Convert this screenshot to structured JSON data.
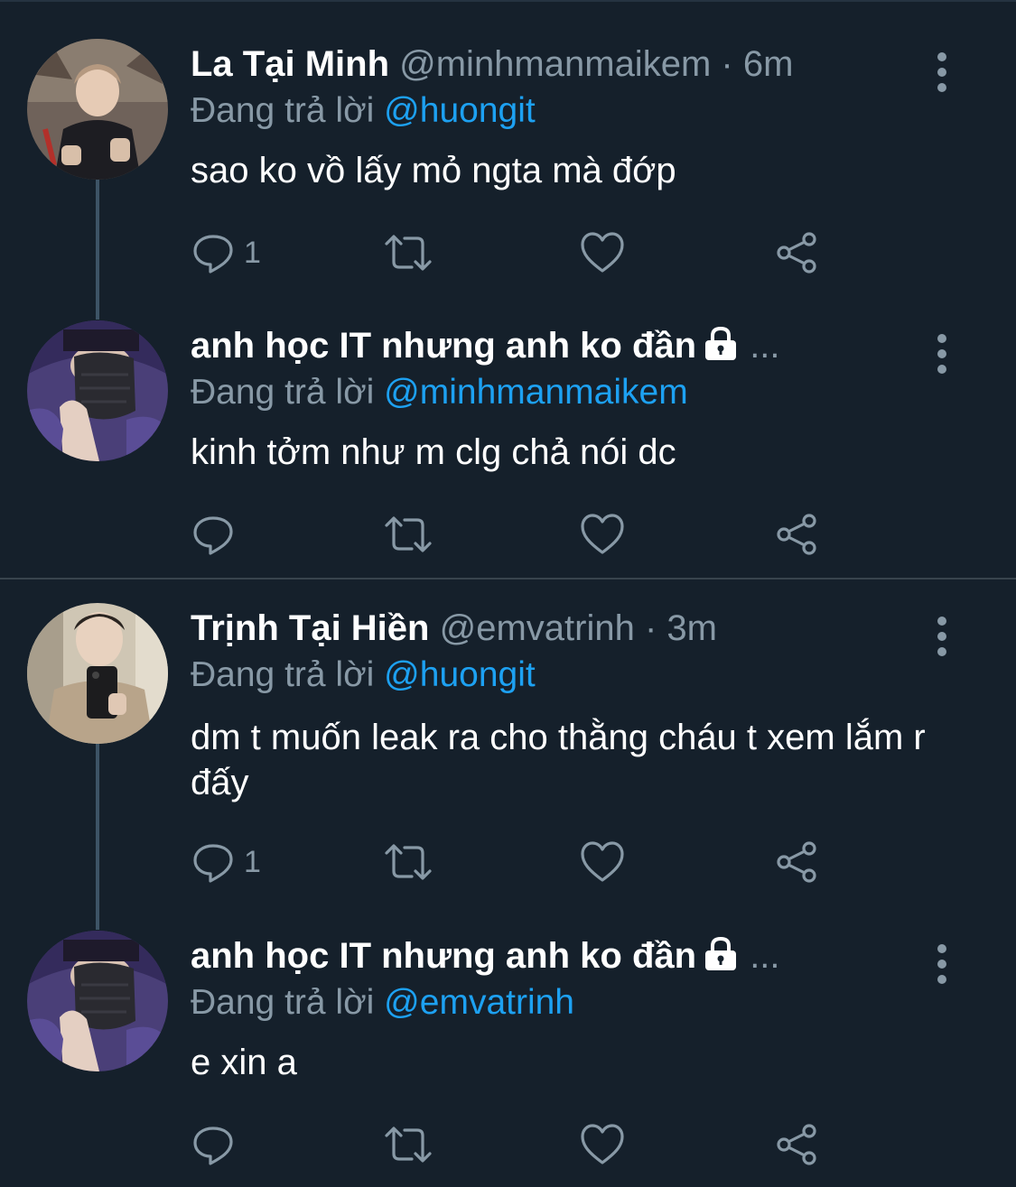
{
  "tweets": [
    {
      "name": "La Tại Minh",
      "handle": "@minhmanmaikem",
      "separator": "·",
      "time": "6m",
      "reply_prefix": "Đang trả lời",
      "reply_to": "@huongit",
      "text": "sao ko vồ lấy mỏ ngta mà đớp",
      "reply_count": "1",
      "locked": false
    },
    {
      "name": "anh học IT nhưng anh ko đần",
      "ellipsis": "...",
      "reply_prefix": "Đang trả lời",
      "reply_to": "@minhmanmaikem",
      "text": "kinh tởm như m clg chả nói dc",
      "reply_count": "",
      "locked": true
    },
    {
      "name": "Trịnh Tại Hiền",
      "handle": "@emvatrinh",
      "separator": "·",
      "time": "3m",
      "reply_prefix": "Đang trả lời",
      "reply_to": "@huongit",
      "text": "dm t muốn leak ra cho thằng cháu t xem lắm r đấy",
      "reply_count": "1",
      "locked": false
    },
    {
      "name": "anh học IT nhưng anh ko đần",
      "ellipsis": "...",
      "reply_prefix": "Đang trả lời",
      "reply_to": "@emvatrinh",
      "text": "e xin a",
      "reply_count": "",
      "locked": true
    }
  ],
  "icons": {
    "reply": "reply-icon",
    "retweet": "retweet-icon",
    "like": "heart-icon",
    "share": "share-icon",
    "more": "more-vertical-icon",
    "lock": "lock-icon"
  },
  "colors": {
    "background": "#15202b",
    "secondary_text": "#8899a6",
    "link": "#1da1f2",
    "divider": "#38444d",
    "thread_line": "#3d5466"
  }
}
